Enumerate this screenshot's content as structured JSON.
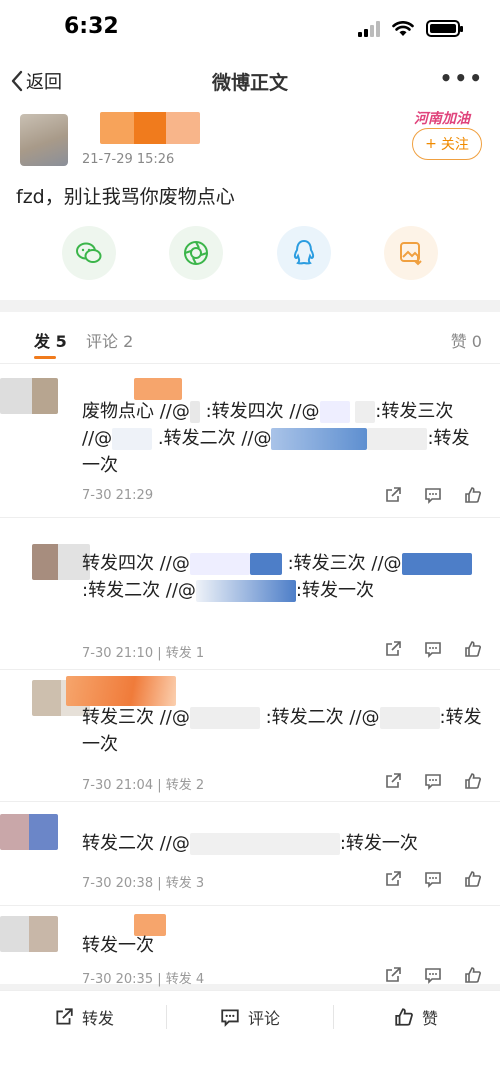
{
  "status_bar": {
    "time": "6:32"
  },
  "nav": {
    "back_label": "返回",
    "title": "微博正文",
    "more": "•••"
  },
  "post": {
    "time": "21-7-29 15:26",
    "text": "fzd，别让我骂你废物点心",
    "badge": "河南加油",
    "follow_label": "关注",
    "share_icons": [
      "wechat-icon",
      "moments-icon",
      "qq-icon",
      "save-image-icon"
    ]
  },
  "tabs": {
    "repost": "发 5",
    "comment": "评论 2",
    "like": "赞 0"
  },
  "reposts": [
    {
      "parts": [
        "废物点心 //@",
        ":转发四次 //@",
        ":转发三次 //@",
        ".转发二次 //@",
        ":转发一次"
      ],
      "time": "7-30 21:29",
      "repost_count": ""
    },
    {
      "parts": [
        "转发四次 //@",
        ":转发三次 //@",
        ":转发二次 //@",
        ":转发一次"
      ],
      "time": "7-30 21:10",
      "repost_count": "转发 1"
    },
    {
      "parts": [
        "转发三次 //@",
        ":转发二次 //@",
        ":转发一次"
      ],
      "time": "7-30 21:04",
      "repost_count": "转发 2"
    },
    {
      "parts": [
        "转发二次 //@",
        ":转发一次"
      ],
      "time": "7-30 20:38",
      "repost_count": "转发 3"
    },
    {
      "parts": [
        "转发一次"
      ],
      "time": "7-30 20:35",
      "repost_count": "转发 4"
    }
  ],
  "bottom_bar": {
    "repost": "转发",
    "comment": "评论",
    "like": "赞"
  }
}
